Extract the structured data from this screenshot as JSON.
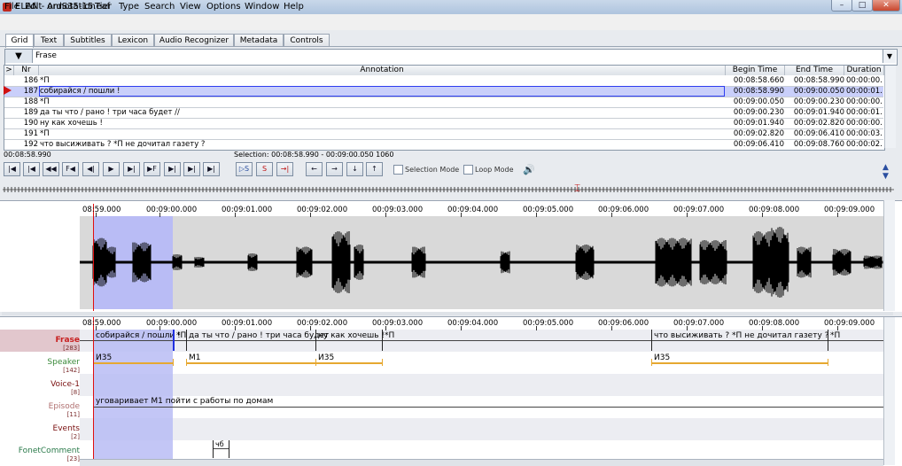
{
  "window": {
    "title": "ELAN - ordS35-15.eaf",
    "controls": [
      "–",
      "□",
      "✕"
    ]
  },
  "menu": [
    "File",
    "Edit",
    "Annotation",
    "Tier",
    "Type",
    "Search",
    "View",
    "Options",
    "Window",
    "Help"
  ],
  "tabs": [
    "Grid",
    "Text",
    "Subtitles",
    "Lexicon",
    "Audio Recognizer",
    "Metadata",
    "Controls"
  ],
  "grid": {
    "tier_selected": "Frase",
    "columns": [
      ">",
      "Nr",
      "Annotation",
      "Begin Time",
      "End Time",
      "Duration"
    ],
    "rows": [
      {
        "nr": "186",
        "annotation": "*П",
        "begin": "00:08:58.660",
        "end": "00:08:58.990",
        "duration": "00:00:00.330"
      },
      {
        "nr": "187",
        "annotation": "собирайся / пошли !",
        "begin": "00:08:58.990",
        "end": "00:09:00.050",
        "duration": "00:00:01.060"
      },
      {
        "nr": "188",
        "annotation": "*П",
        "begin": "00:09:00.050",
        "end": "00:09:00.230",
        "duration": "00:00:00.180"
      },
      {
        "nr": "189",
        "annotation": "да ты что / рано ! три часа будет //",
        "begin": "00:09:00.230",
        "end": "00:09:01.940",
        "duration": "00:00:01.710"
      },
      {
        "nr": "190",
        "annotation": "ну как хочешь !",
        "begin": "00:09:01.940",
        "end": "00:09:02.820",
        "duration": "00:00:00.880"
      },
      {
        "nr": "191",
        "annotation": "*П",
        "begin": "00:09:02.820",
        "end": "00:09:06.410",
        "duration": "00:00:03.590"
      },
      {
        "nr": "192",
        "annotation": "что высиживать ? *П не дочитал газету ?",
        "begin": "00:09:06.410",
        "end": "00:09:08.760",
        "duration": "00:00:02.350"
      }
    ]
  },
  "controls": {
    "current_time": "00:08:58.990",
    "selection": "Selection: 00:08:58.990 - 00:09:00.050  1060",
    "transport": [
      "|◀",
      "|◀",
      "◀◀",
      "F◀",
      "◀|",
      "▶",
      "▶|",
      "▶F",
      "▶|",
      "▶|",
      "▶|"
    ],
    "selection_buttons": [
      "▷S",
      "S",
      "→|"
    ],
    "nav_buttons": [
      "←",
      "→",
      "↓",
      "↑"
    ],
    "selection_mode": "Selection Mode",
    "loop_mode": "Loop Mode"
  },
  "timeline": {
    "ticks": [
      "08:59.000",
      "00:09:00.000",
      "00:09:01.000",
      "00:09:02.000",
      "00:09:03.000",
      "00:09:04.000",
      "00:09:05.000",
      "00:09:06.000",
      "00:09:07.000",
      "00:09:08.000",
      "00:09:09.000"
    ]
  },
  "tiers": [
    {
      "name": "Frase",
      "count": "[283]",
      "color": "#c82020"
    },
    {
      "name": "Speaker",
      "count": "[142]",
      "color": "#3a8a3a"
    },
    {
      "name": "Voice-1",
      "count": "[8]",
      "color": "#7a1010"
    },
    {
      "name": "Episode",
      "count": "[11]",
      "color": "#b07070"
    },
    {
      "name": "Events",
      "count": "[2]",
      "color": "#7a1010"
    },
    {
      "name": "FonetComment",
      "count": "[23]",
      "color": "#2a7a4a"
    }
  ],
  "tier_annotations": {
    "frase": [
      "собирайся / пошли !",
      "*П",
      "да ты что / рано ! три часа будет",
      "ну как хочешь !",
      "*П",
      "что высиживать ? *П не дочитал газету ?",
      "*П"
    ],
    "speaker": [
      "И35",
      "М1",
      "И35",
      "И35"
    ],
    "episode": [
      "уговаривает М1 пойти с работы по домам"
    ],
    "fonet": [
      "чб"
    ]
  }
}
